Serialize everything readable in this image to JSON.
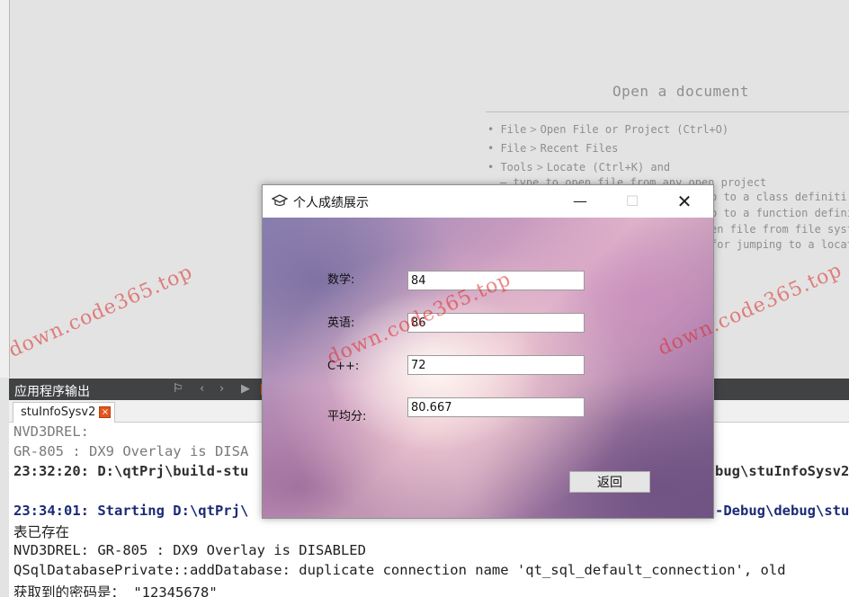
{
  "welcome": {
    "title": "Open a document",
    "tips": [
      {
        "head": "• File",
        "arrow": ">",
        "tail": "Open File or Project (Ctrl+O)"
      },
      {
        "head": "• File",
        "arrow": ">",
        "tail": "Recent Files"
      },
      {
        "head": "• Tools",
        "arrow": ">",
        "tail": "Locate (Ctrl+K) and"
      }
    ],
    "tip3_cont": "– type to open file from any open project",
    "fragments": [
      "p to a class definiti",
      "p to a function defini",
      "en file from file syst",
      "for jumping to a locat"
    ]
  },
  "output_panel": {
    "title": "应用程序输出",
    "tab_label": "stuInfoSysv2",
    "tab_close": "×",
    "lines": [
      "NVD3DREL:",
      "GR-805 : DX9 Overlay is DISA",
      "23:32:20: D:\\qtPrj\\build-stu",
      "bug\\stuInfoSysv2",
      "23:34:01: Starting D:\\qtPrj\\",
      "-Debug\\debug\\stu",
      "表已存在",
      "NVD3DREL: GR-805 : DX9 Overlay is DISABLED",
      "QSqlDatabasePrivate::addDatabase: duplicate connection name 'qt_sql_default_connection', old",
      "获取到的密码是： \"12345678\""
    ]
  },
  "dialog": {
    "title": "个人成绩展示",
    "min_glyph": "—",
    "max_glyph": "☐",
    "close_glyph": "✕",
    "fields": [
      {
        "label": "数学:",
        "value": "84"
      },
      {
        "label": "英语:",
        "value": "86"
      },
      {
        "label": "C++:",
        "value": "72"
      },
      {
        "label": "平均分:",
        "value": "80.667"
      }
    ],
    "return_label": "返回"
  },
  "watermark": "down.code365.top"
}
